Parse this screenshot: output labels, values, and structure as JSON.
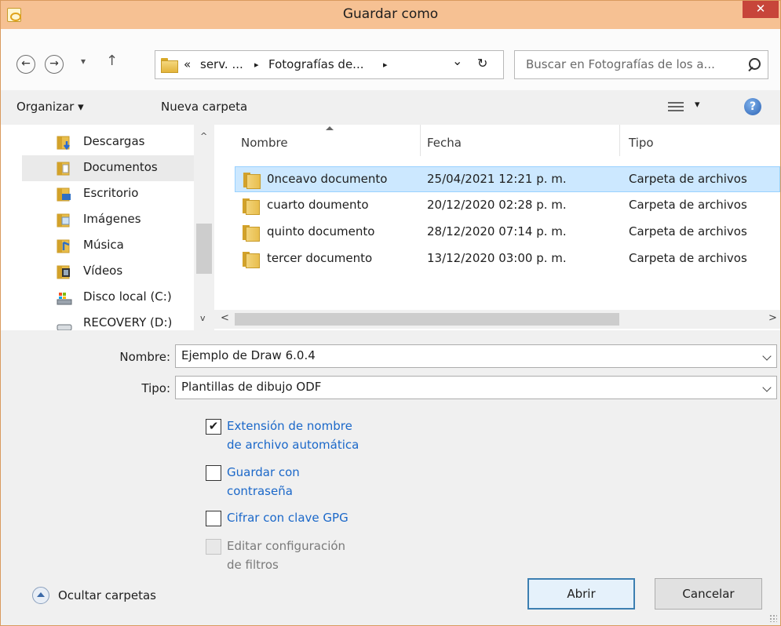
{
  "window": {
    "title": "Guardar como",
    "close_symbol": "✕"
  },
  "nav": {
    "back_symbol": "←",
    "forward_symbol": "→",
    "recent_symbol": "▾",
    "up_symbol": "↑",
    "breadcrumb": {
      "prefix": "«",
      "segments": [
        "serv. ...",
        "Fotografías de..."
      ],
      "separator": "▸"
    },
    "dropdown_symbol": "⌄",
    "refresh_symbol": "↻"
  },
  "search": {
    "placeholder": "Buscar en Fotografías de los a..."
  },
  "toolbar": {
    "organize_label": "Organizar ▾",
    "new_folder_label": "Nueva carpeta",
    "view_dropdown_symbol": "▾",
    "help_symbol": "?"
  },
  "nav_pane": {
    "items": [
      {
        "label": "Descargas",
        "icon": "downloads-folder-icon"
      },
      {
        "label": "Documentos",
        "icon": "documents-folder-icon",
        "selected": true
      },
      {
        "label": "Escritorio",
        "icon": "desktop-folder-icon"
      },
      {
        "label": "Imágenes",
        "icon": "pictures-folder-icon"
      },
      {
        "label": "Música",
        "icon": "music-folder-icon"
      },
      {
        "label": "Vídeos",
        "icon": "videos-folder-icon"
      },
      {
        "label": "Disco local (C:)",
        "icon": "local-disk-icon"
      },
      {
        "label": "RECOVERY (D:)",
        "icon": "drive-icon"
      }
    ],
    "scroll_up": "^",
    "scroll_down": "v"
  },
  "file_list": {
    "columns": [
      "Nombre",
      "Fecha",
      "Tipo"
    ],
    "rows": [
      {
        "name": "0nceavo documento",
        "date": "25/04/2021 12:21 p. m.",
        "type": "Carpeta de archivos",
        "selected": true
      },
      {
        "name": "cuarto doumento",
        "date": "20/12/2020 02:28 p. m.",
        "type": "Carpeta de archivos"
      },
      {
        "name": "quinto documento",
        "date": "28/12/2020 07:14 p. m.",
        "type": "Carpeta de archivos"
      },
      {
        "name": "tercer documento",
        "date": "13/12/2020 03:00 p. m.",
        "type": "Carpeta de archivos"
      }
    ],
    "scroll_left": "<",
    "scroll_right": ">"
  },
  "form": {
    "name_label": "Nombre:",
    "name_value": "Ejemplo de Draw 6.0.4",
    "type_label": "Tipo:",
    "type_value": "Plantillas de dibujo ODF"
  },
  "options": [
    {
      "line1": "Extensión de nombre",
      "line2": "de archivo automática",
      "checked": true,
      "enabled": true,
      "check_mark": "✔"
    },
    {
      "line1": "Guardar con",
      "line2": "contraseña",
      "checked": false,
      "enabled": true
    },
    {
      "line1": "Cifrar con clave GPG",
      "line2": "",
      "checked": false,
      "enabled": true
    },
    {
      "line1": "Editar configuración",
      "line2": "de filtros",
      "checked": false,
      "enabled": false
    }
  ],
  "footer": {
    "hide_folders_label": "Ocultar carpetas",
    "open_button": "Abrir",
    "cancel_button": "Cancelar"
  },
  "colors": {
    "title_bar": "#f6c193",
    "close_button": "#c7453a",
    "selection": "#cce8ff",
    "link_text": "#1b68c9"
  }
}
